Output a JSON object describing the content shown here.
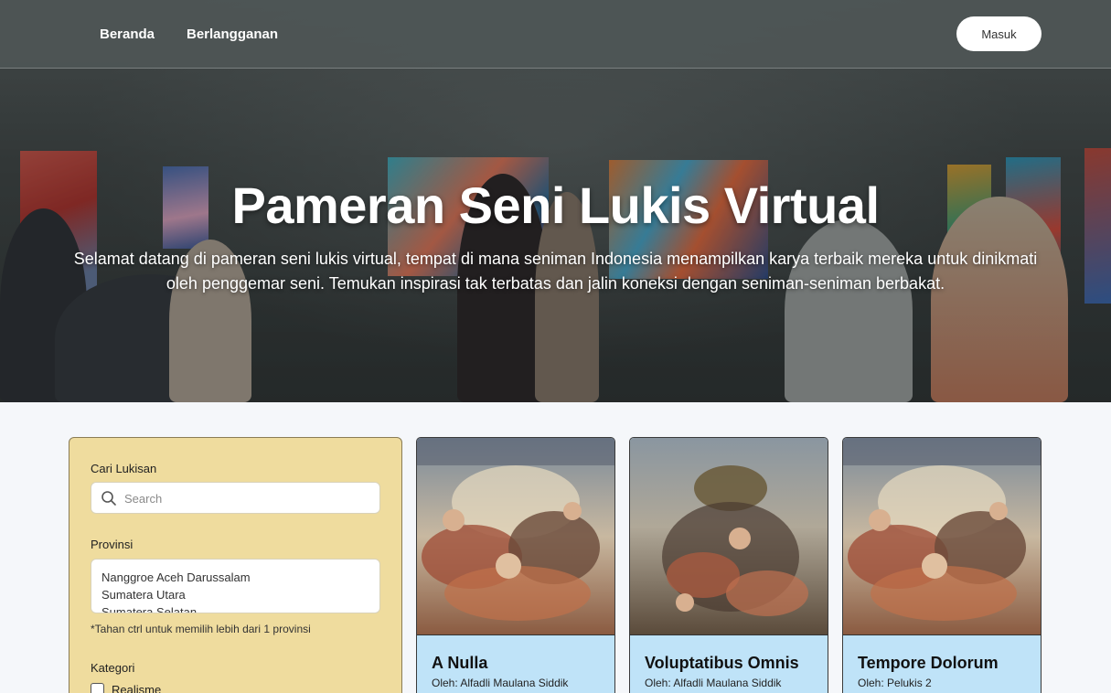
{
  "nav": {
    "links": [
      "Beranda",
      "Berlangganan"
    ],
    "login_label": "Masuk"
  },
  "hero": {
    "title": "Pameran Seni Lukis Virtual",
    "subtitle": "Selamat datang di pameran seni lukis virtual, tempat di mana seniman Indonesia menampilkan karya terbaik mereka untuk dinikmati oleh penggemar seni. Temukan inspirasi tak terbatas dan jalin koneksi dengan seniman-seniman berbakat."
  },
  "filter": {
    "search_label": "Cari Lukisan",
    "search_placeholder": "Search",
    "province_label": "Provinsi",
    "provinces": [
      "Nanggroe Aceh Darussalam",
      "Sumatera Utara",
      "Sumatera Selatan"
    ],
    "province_hint": "*Tahan ctrl untuk memilih lebih dari 1 provinsi",
    "category_label": "Kategori",
    "categories": [
      "Realisme"
    ]
  },
  "cards": [
    {
      "title": "A Nulla",
      "author": "Oleh: Alfadli Maulana Siddik"
    },
    {
      "title": "Voluptatibus Omnis",
      "author": "Oleh: Alfadli Maulana Siddik"
    },
    {
      "title": "Tempore Dolorum",
      "author": "Oleh: Pelukis 2"
    }
  ],
  "colors": {
    "navbar": "#4e5656",
    "filter_panel": "#efdc9e",
    "card_body": "#bfe3f8",
    "login_button": "#ffffff"
  }
}
